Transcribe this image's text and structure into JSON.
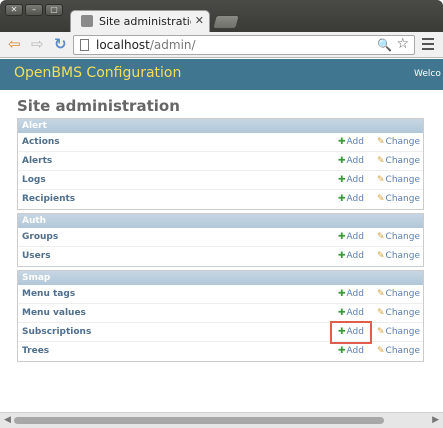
{
  "window": {
    "buttons": [
      "✕",
      "–",
      "▢"
    ]
  },
  "tab": {
    "title": "Site administration | D",
    "close": "✕"
  },
  "toolbar": {
    "back": "⇦",
    "forward": "⇨",
    "reload": "↻",
    "url_host": "localhost",
    "url_path": "/admin/",
    "zoom": "🔍",
    "star": "☆"
  },
  "header": {
    "branding": "OpenBMS Configuration",
    "user_tools": "Welco"
  },
  "page": {
    "title": "Site administration"
  },
  "links": {
    "add": "Add",
    "change": "Change"
  },
  "modules": [
    {
      "caption": "Alert",
      "rows": [
        "Actions",
        "Alerts",
        "Logs",
        "Recipients"
      ]
    },
    {
      "caption": "Auth",
      "rows": [
        "Groups",
        "Users"
      ]
    },
    {
      "caption": "Smap",
      "rows": [
        "Menu tags",
        "Menu values",
        "Subscriptions",
        "Trees"
      ]
    }
  ],
  "colors": {
    "header_bg": "#417690",
    "branding": "#f5dd5d",
    "caption_bg": "#b1c8d9",
    "link": "#5b80b2",
    "highlight": "#e05d4f"
  },
  "icons": {
    "add": "add-icon",
    "change": "pencil-icon"
  },
  "scrollbar": {
    "left": "◀",
    "right": "▶"
  }
}
